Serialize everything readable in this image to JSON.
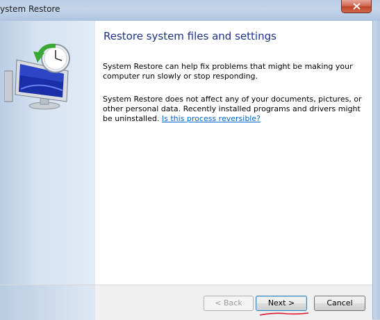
{
  "window": {
    "title": "ystem Restore"
  },
  "content": {
    "heading": "Restore system files and settings",
    "paragraph1": "System Restore can help fix problems that might be making your computer run slowly or stop responding.",
    "paragraph2": "System Restore does not affect any of your documents, pictures, or other personal data. Recently installed programs and drivers might be uninstalled.",
    "link_text": "Is this process reversible?"
  },
  "buttons": {
    "back": "< Back",
    "next": "Next >",
    "cancel": "Cancel",
    "back_enabled": false
  },
  "colors": {
    "heading": "#1e3287",
    "link": "#0066cc",
    "annotation": "#e0162a"
  },
  "icons": {
    "app_icon": "system-restore-icon",
    "close": "close-icon"
  }
}
